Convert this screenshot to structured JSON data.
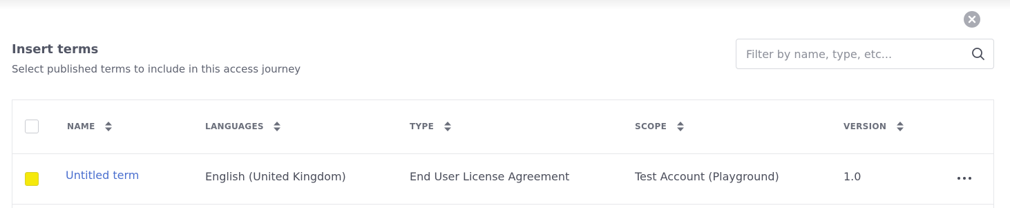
{
  "dialog": {
    "title": "Insert terms",
    "subtitle": "Select published terms to include in this access journey",
    "close_icon": "close-icon"
  },
  "search": {
    "placeholder": "Filter by name, type, etc...",
    "value": "",
    "icon": "search-icon"
  },
  "table": {
    "columns": [
      {
        "label": "NAME",
        "sortable": true
      },
      {
        "label": "LANGUAGES",
        "sortable": true
      },
      {
        "label": "TYPE",
        "sortable": true
      },
      {
        "label": "SCOPE",
        "sortable": true
      },
      {
        "label": "VERSION",
        "sortable": true
      }
    ],
    "rows": [
      {
        "name": "Untitled term",
        "languages": "English (United Kingdom)",
        "type": "End User License Agreement",
        "scope": "Test Account (Playground)",
        "version": "1.0",
        "checked": false,
        "actions_icon": "more-options-icon"
      }
    ]
  },
  "colors": {
    "link": "#4a6fcf",
    "highlight": "#f5e90b",
    "border": "#e6e7ea",
    "close_bg": "#a9abb3"
  }
}
